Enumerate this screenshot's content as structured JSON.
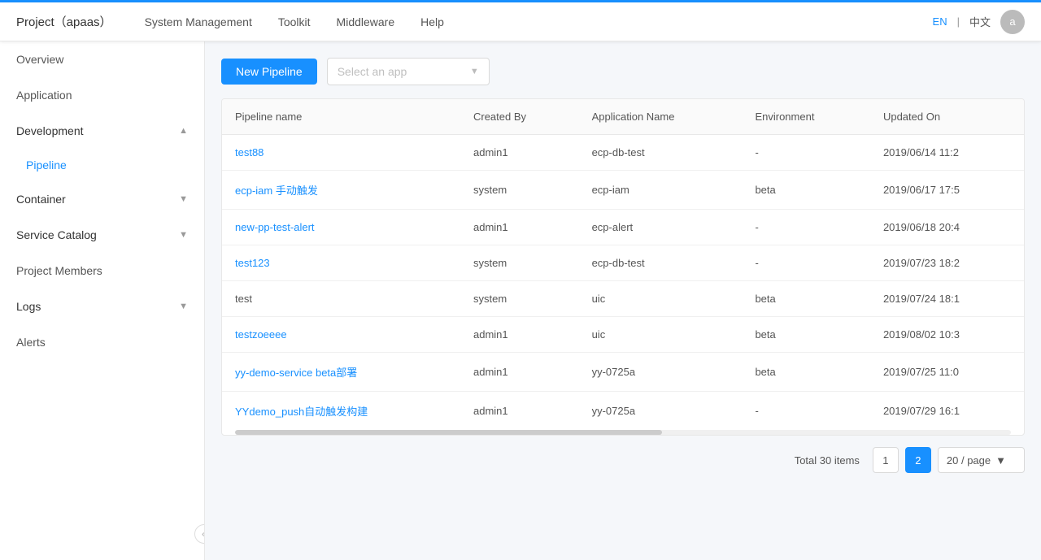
{
  "topAccent": true,
  "nav": {
    "brand": "Project（apaas）",
    "items": [
      "System Management",
      "Toolkit",
      "Middleware",
      "Help"
    ],
    "lang": {
      "en": "EN",
      "sep": "|",
      "zh": "中文"
    },
    "avatar": "a"
  },
  "sidebar": {
    "items": [
      {
        "id": "overview",
        "label": "Overview",
        "type": "top",
        "active": false
      },
      {
        "id": "application",
        "label": "Application",
        "type": "top",
        "active": false
      },
      {
        "id": "development",
        "label": "Development",
        "type": "parent",
        "expanded": true
      },
      {
        "id": "pipeline",
        "label": "Pipeline",
        "type": "child",
        "active": true
      },
      {
        "id": "container",
        "label": "Container",
        "type": "parent",
        "expanded": false
      },
      {
        "id": "service-catalog",
        "label": "Service Catalog",
        "type": "parent",
        "expanded": false
      },
      {
        "id": "project-members",
        "label": "Project Members",
        "type": "top",
        "active": false
      },
      {
        "id": "logs",
        "label": "Logs",
        "type": "parent",
        "expanded": false
      },
      {
        "id": "alerts",
        "label": "Alerts",
        "type": "top",
        "active": false
      }
    ]
  },
  "toolbar": {
    "newPipelineLabel": "New Pipeline",
    "selectPlaceholder": "Select an app"
  },
  "table": {
    "columns": [
      "Pipeline name",
      "Created By",
      "Application Name",
      "Environment",
      "Updated On"
    ],
    "rows": [
      {
        "pipelineName": "test88",
        "createdBy": "admin1",
        "appName": "ecp-db-test",
        "environment": "-",
        "updatedOn": "2019/06/14 11:2",
        "isLink": true
      },
      {
        "pipelineName": "ecp-iam 手动触发",
        "createdBy": "system",
        "appName": "ecp-iam",
        "environment": "beta",
        "updatedOn": "2019/06/17 17:5",
        "isLink": true
      },
      {
        "pipelineName": "new-pp-test-alert",
        "createdBy": "admin1",
        "appName": "ecp-alert",
        "environment": "-",
        "updatedOn": "2019/06/18 20:4",
        "isLink": true
      },
      {
        "pipelineName": "test123",
        "createdBy": "system",
        "appName": "ecp-db-test",
        "environment": "-",
        "updatedOn": "2019/07/23 18:2",
        "isLink": true
      },
      {
        "pipelineName": "test",
        "createdBy": "system",
        "appName": "uic",
        "environment": "beta",
        "updatedOn": "2019/07/24 18:1",
        "isLink": false
      },
      {
        "pipelineName": "testzoeeee",
        "createdBy": "admin1",
        "appName": "uic",
        "environment": "beta",
        "updatedOn": "2019/08/02 10:3",
        "isLink": true
      },
      {
        "pipelineName": "yy-demo-service beta部署",
        "createdBy": "admin1",
        "appName": "yy-0725a",
        "environment": "beta",
        "updatedOn": "2019/07/25 11:0",
        "isLink": true
      },
      {
        "pipelineName": "YYdemo_push自动触发构建",
        "createdBy": "admin1",
        "appName": "yy-0725a",
        "environment": "-",
        "updatedOn": "2019/07/29 16:1",
        "isLink": true
      }
    ]
  },
  "pagination": {
    "totalLabel": "Total 30 items",
    "page1": "1",
    "page2": "2",
    "pageSizeLabel": "20 / page"
  }
}
